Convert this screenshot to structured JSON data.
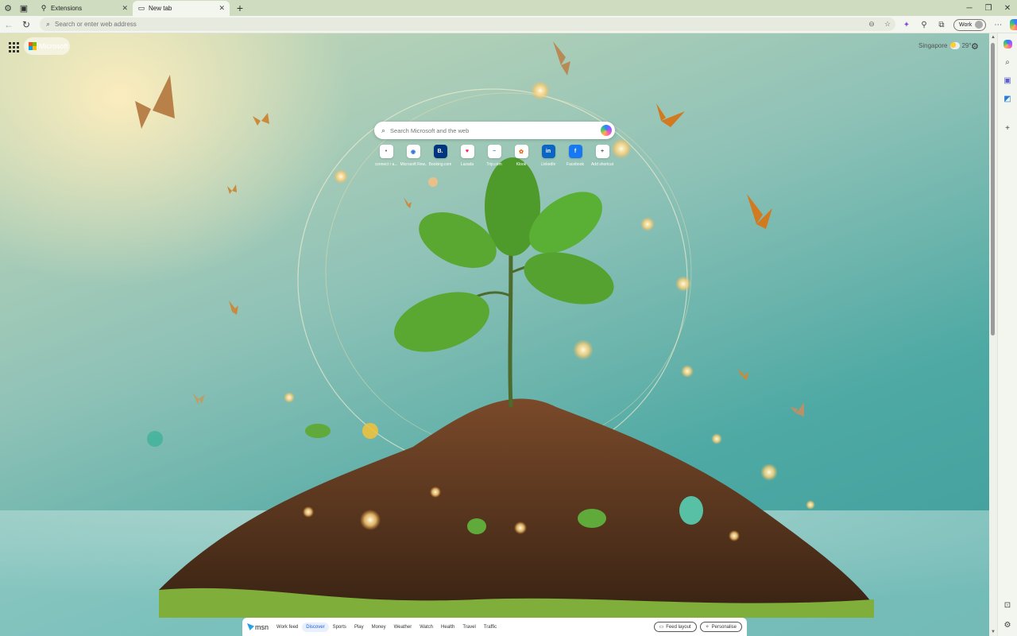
{
  "tabs": [
    {
      "label": "Extensions",
      "favicon": "puzzle-icon"
    },
    {
      "label": "New tab",
      "favicon": "page-icon"
    }
  ],
  "toolbar": {
    "address_placeholder": "Search or enter web address",
    "profile_label": "Work"
  },
  "newtab": {
    "brand": "Microsoft",
    "weather": {
      "city": "Singapore",
      "temp": "29°"
    },
    "search_placeholder": "Search Microsoft and the web",
    "quick_links": [
      {
        "label": "connect r a...",
        "glyph": "•",
        "color": "#666666"
      },
      {
        "label": "Microsoft Rew...",
        "glyph": "◉",
        "color": "#2f6fd6"
      },
      {
        "label": "Booking.com",
        "glyph": "B.",
        "color": "#ffffff",
        "bg": "#003580"
      },
      {
        "label": "Lazada",
        "glyph": "♥",
        "color": "#f0145a"
      },
      {
        "label": "Trip.com",
        "glyph": "~",
        "color": "#2a7fff"
      },
      {
        "label": "Klook",
        "glyph": "✿",
        "color": "#ff5b00"
      },
      {
        "label": "LinkedIn",
        "glyph": "in",
        "color": "#ffffff",
        "bg": "#0a66c2"
      },
      {
        "label": "Facebook",
        "glyph": "f",
        "color": "#ffffff",
        "bg": "#1877f2"
      },
      {
        "label": "Add shortcut",
        "glyph": "+",
        "color": "#555555"
      }
    ]
  },
  "feed": {
    "brand": "msn",
    "items": [
      "Work feed",
      "Discover",
      "Sports",
      "Play",
      "Money",
      "Weather",
      "Watch",
      "Health",
      "Travel",
      "Traffic"
    ],
    "active_item": "Discover",
    "feed_layout_label": "Feed layout",
    "personalise_label": "Personalise"
  }
}
